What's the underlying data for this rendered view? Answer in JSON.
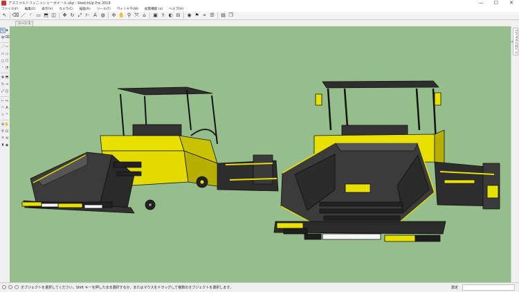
{
  "window": {
    "title": "アスファルトフィニッシャーボイール.skp - SketchUp Pro 2019",
    "minimize": "—",
    "maximize": "☐",
    "close": "✕"
  },
  "menu": [
    "ファイル(F)",
    "編集(E)",
    "表示(V)",
    "カメラ(C)",
    "描画(R)",
    "ツール(T)",
    "ウィンドウ(W)",
    "拡張機能 (x)",
    "ヘルプ(H)"
  ],
  "toolbar": [
    {
      "name": "select-tool-icon",
      "glyph": "↖"
    },
    {
      "name": "eraser-tool-icon",
      "glyph": "⌫"
    },
    {
      "name": "line-tool-icon",
      "glyph": "／"
    },
    {
      "name": "arc-tool-icon",
      "glyph": "◜"
    },
    {
      "name": "shape-tool-icon",
      "glyph": "▭"
    },
    {
      "name": "push-pull-tool-icon",
      "glyph": "⬒"
    },
    {
      "name": "offset-tool-icon",
      "glyph": "◫"
    },
    {
      "name": "move-tool-icon",
      "glyph": "✥"
    },
    {
      "name": "rotate-tool-icon",
      "glyph": "↻"
    },
    {
      "name": "scale-tool-icon",
      "glyph": "⤢"
    },
    {
      "name": "tape-measure-tool-icon",
      "glyph": "⊢"
    },
    {
      "name": "text-tool-icon",
      "glyph": "A"
    },
    {
      "name": "paint-bucket-tool-icon",
      "glyph": "◍"
    },
    {
      "name": "orbit-tool-icon",
      "glyph": "✣"
    },
    {
      "name": "pan-tool-icon",
      "glyph": "✋"
    },
    {
      "name": "zoom-tool-icon",
      "glyph": "⚲"
    },
    {
      "name": "zoom-extents-tool-icon",
      "glyph": "⤧"
    },
    {
      "name": "warehouse-icon",
      "glyph": "⌂"
    },
    {
      "name": "extension-warehouse-icon",
      "glyph": "▣"
    },
    {
      "name": "share-model-icon",
      "glyph": "⇪"
    },
    {
      "name": "styles-icon",
      "glyph": "◐"
    },
    {
      "name": "section-plane-icon",
      "glyph": "⊟"
    },
    {
      "name": "camera-position-icon",
      "glyph": "◉"
    },
    {
      "name": "walk-icon",
      "glyph": "⚑"
    },
    {
      "name": "look-around-icon",
      "glyph": "⌖"
    },
    {
      "name": "outliner-icon",
      "glyph": "☰"
    },
    {
      "name": "layers-icon",
      "glyph": "▤"
    },
    {
      "name": "components-icon",
      "glyph": "❒"
    }
  ],
  "scene_tab": "シーン 1",
  "left_tools": [
    {
      "name": "select-icon",
      "glyph": "↖"
    },
    {
      "name": "make-component-icon",
      "glyph": "◈"
    },
    {
      "name": "paint-icon",
      "glyph": "◍"
    },
    {
      "name": "eraser-icon",
      "glyph": "⌫"
    },
    {
      "name": "line-icon",
      "glyph": "／"
    },
    {
      "name": "freehand-icon",
      "glyph": "〰"
    },
    {
      "name": "rectangle-icon",
      "glyph": "▭"
    },
    {
      "name": "rotated-rectangle-icon",
      "glyph": "◇"
    },
    {
      "name": "circle-icon",
      "glyph": "○"
    },
    {
      "name": "polygon-icon",
      "glyph": "⬡"
    },
    {
      "name": "arc-icon",
      "glyph": "◜"
    },
    {
      "name": "pie-icon",
      "glyph": "◔"
    },
    {
      "name": "move-icon",
      "glyph": "✥"
    },
    {
      "name": "push-pull-icon",
      "glyph": "⬒"
    },
    {
      "name": "rotate-icon",
      "glyph": "↻"
    },
    {
      "name": "follow-me-icon",
      "glyph": "⇝"
    },
    {
      "name": "scale-icon",
      "glyph": "⤢"
    },
    {
      "name": "offset-icon",
      "glyph": "◫"
    },
    {
      "name": "tape-measure-icon",
      "glyph": "⊢"
    },
    {
      "name": "dimension-icon",
      "glyph": "↔"
    },
    {
      "name": "protractor-icon",
      "glyph": "◠"
    },
    {
      "name": "text-icon",
      "glyph": "A"
    },
    {
      "name": "axes-icon",
      "glyph": "⊹"
    },
    {
      "name": "3d-text-icon",
      "glyph": "ᴬ"
    },
    {
      "name": "orbit-icon",
      "glyph": "✣"
    },
    {
      "name": "pan-icon",
      "glyph": "✋"
    },
    {
      "name": "zoom-icon",
      "glyph": "⚲"
    },
    {
      "name": "zoom-window-icon",
      "glyph": "⊡"
    },
    {
      "name": "zoom-extents-icon",
      "glyph": "⤧"
    },
    {
      "name": "previous-view-icon",
      "glyph": "⟲"
    },
    {
      "name": "position-camera-icon",
      "glyph": "♜"
    },
    {
      "name": "look-around-icon-left",
      "glyph": "◉"
    }
  ],
  "tray_tab": "デフォルトのトレイ",
  "status": {
    "text": "オブジェクトを選択してください。Shift キーを押したまま選択するか、またはマウスをドラッグして複数のオブジェクトを選択します。",
    "measure_label": "測定",
    "measure_value": ""
  },
  "colors": {
    "viewport": "#96bd8c",
    "machine_yellow": "#e8e000",
    "machine_dark": "#3b3b3b"
  }
}
